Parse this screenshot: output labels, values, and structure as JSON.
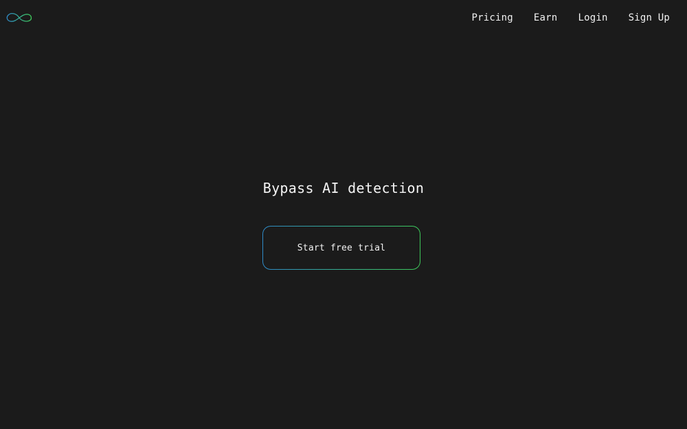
{
  "header": {
    "logo_icon": "infinity-icon",
    "logo_colors": {
      "left": "#2f8bc9",
      "right": "#3ec95a"
    },
    "nav": [
      {
        "label": "Pricing"
      },
      {
        "label": "Earn"
      },
      {
        "label": "Login"
      },
      {
        "label": "Sign Up"
      }
    ]
  },
  "hero": {
    "title": "Bypass AI detection",
    "cta_label": "Start free trial",
    "cta_gradient": [
      "#2f8bc9",
      "#37b58a",
      "#3ec95a"
    ]
  },
  "colors": {
    "background": "#1b1b1b",
    "text": "#f2f2f2"
  }
}
